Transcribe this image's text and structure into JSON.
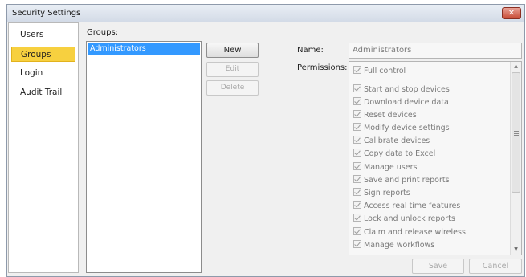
{
  "window": {
    "title": "Security Settings",
    "close_glyph": "✕"
  },
  "nav": {
    "items": [
      {
        "label": "Users",
        "selected": false
      },
      {
        "label": "Groups",
        "selected": true
      },
      {
        "label": "Login",
        "selected": false
      },
      {
        "label": "Audit Trail",
        "selected": false
      }
    ]
  },
  "groups": {
    "label": "Groups:",
    "items": [
      "Administrators"
    ],
    "selected": "Administrators"
  },
  "group_buttons": {
    "new": "New",
    "edit": "Edit",
    "delete": "Delete"
  },
  "details": {
    "name_label": "Name:",
    "name_value": "Administrators",
    "permissions_label": "Permissions:",
    "permissions": [
      {
        "label": "Full control",
        "checked": true
      },
      {
        "label": "Start and stop devices",
        "checked": true
      },
      {
        "label": "Download device data",
        "checked": true
      },
      {
        "label": "Reset devices",
        "checked": true
      },
      {
        "label": "Modify device settings",
        "checked": true
      },
      {
        "label": "Calibrate devices",
        "checked": true
      },
      {
        "label": "Copy data to Excel",
        "checked": true
      },
      {
        "label": "Manage users",
        "checked": true
      },
      {
        "label": "Save and print reports",
        "checked": true
      },
      {
        "label": "Sign reports",
        "checked": true
      },
      {
        "label": "Access real time features",
        "checked": true
      },
      {
        "label": "Lock and unlock reports",
        "checked": true
      },
      {
        "label": "Claim and release wireless",
        "checked": true
      },
      {
        "label": "Manage workflows",
        "checked": true
      }
    ]
  },
  "footer": {
    "save": "Save",
    "cancel": "Cancel"
  },
  "colors": {
    "selected_nav": "#f7d03f",
    "selected_row": "#3399ff",
    "close_button": "#c84b35"
  }
}
